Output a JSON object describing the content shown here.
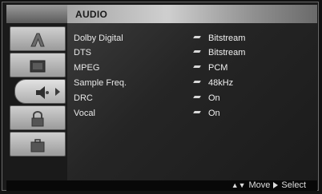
{
  "header": {
    "title": "AUDIO"
  },
  "sidebar": {
    "items": [
      {
        "icon": "font-a-icon"
      },
      {
        "icon": "screen-icon"
      },
      {
        "icon": "speaker-icon",
        "active": true
      },
      {
        "icon": "lock-icon"
      },
      {
        "icon": "briefcase-icon"
      }
    ]
  },
  "settings": [
    {
      "label": "Dolby Digital",
      "value": "Bitstream"
    },
    {
      "label": "DTS",
      "value": "Bitstream"
    },
    {
      "label": "MPEG",
      "value": "PCM"
    },
    {
      "label": "Sample Freq.",
      "value": "48kHz"
    },
    {
      "label": "DRC",
      "value": "On"
    },
    {
      "label": "Vocal",
      "value": "On"
    }
  ],
  "footer": {
    "move_label": "Move",
    "select_label": "Select"
  }
}
